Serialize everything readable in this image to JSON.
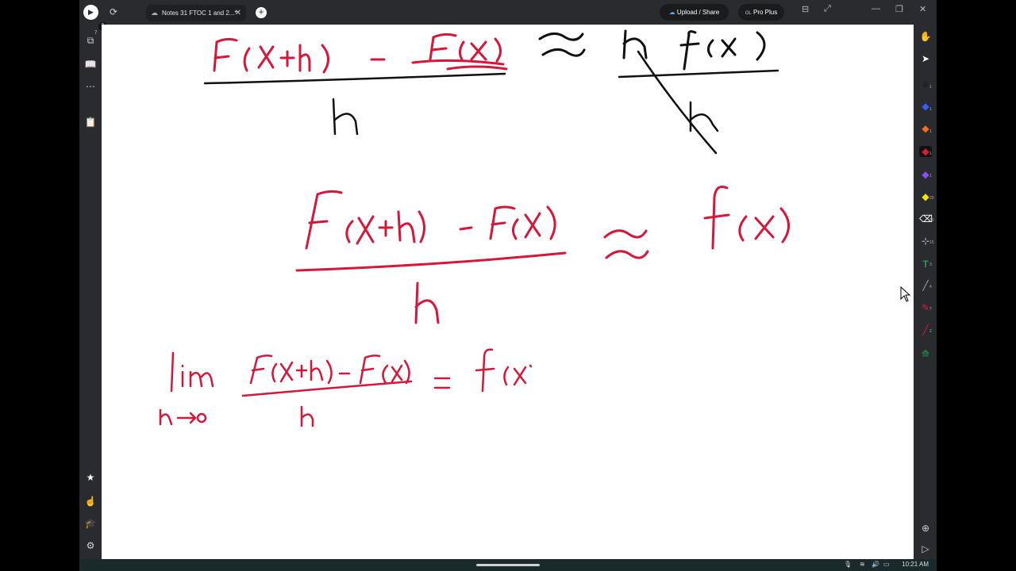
{
  "tab": {
    "title": "Notes 31 FTOC 1 and 2...*"
  },
  "header": {
    "upload_label": "Upload / Share",
    "plan_label": "Pro Plus",
    "plan_icon_text": "OL"
  },
  "left_rail": {
    "badge_pages": "7",
    "badge_p": "P"
  },
  "right_rail": {
    "counts": [
      "1",
      "1",
      "1",
      "1",
      "1",
      "20",
      "50",
      "15",
      "3",
      "4",
      "7",
      "2"
    ]
  },
  "taskbar": {
    "time": "10:21 AM"
  },
  "colors": {
    "ink_black": "#111111",
    "ink_red": "#d8163a",
    "chrome": "#2a2b2e"
  }
}
